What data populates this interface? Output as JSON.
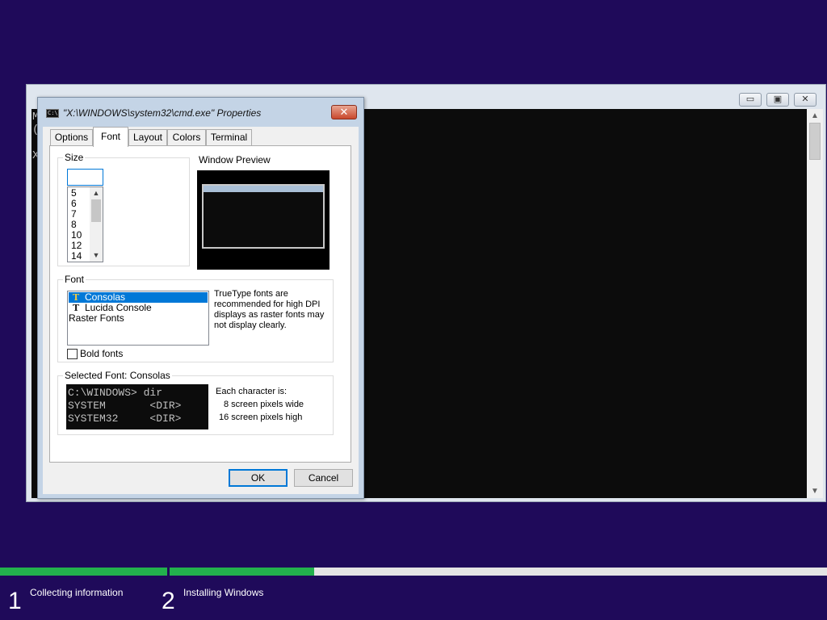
{
  "colors": {
    "desktop_bg": "#1f0a5a",
    "progress": "#23b14d",
    "selection": "#0078d7",
    "close_button": "#c9482c"
  },
  "console": {
    "lines": [
      "M",
      "(",
      "",
      "X"
    ],
    "caption_buttons": [
      "minimize-icon",
      "maximize-icon",
      "close-icon"
    ],
    "caption_glyphs": {
      "minimize": "▭",
      "maximize": "▣",
      "close": "✕"
    },
    "scroll_up": "▲",
    "scroll_down": "▼"
  },
  "dialog": {
    "title": "\"X:\\WINDOWS\\system32\\cmd.exe\" Properties",
    "title_icon_text": "C:\\",
    "close_glyph": "✕",
    "tabs": [
      "Options",
      "Font",
      "Layout",
      "Colors",
      "Terminal"
    ],
    "active_tab": "Font",
    "size": {
      "label": "Size",
      "input_value": "",
      "items": [
        "5",
        "6",
        "7",
        "8",
        "10",
        "12",
        "14"
      ],
      "scroll_up": "▲",
      "scroll_down": "▼"
    },
    "preview": {
      "label": "Window Preview"
    },
    "font": {
      "label": "Font",
      "items": [
        {
          "name": "Consolas",
          "icon": "truetype-icon",
          "glyph": "T",
          "selected": true
        },
        {
          "name": "Lucida Console",
          "icon": "truetype-icon",
          "glyph": "T",
          "selected": false
        },
        {
          "name": "Raster Fonts",
          "icon": "",
          "glyph": "",
          "selected": false
        }
      ],
      "hint": "TrueType fonts are recommended for high DPI displays as raster fonts may not display clearly.",
      "bold_label": "Bold fonts",
      "bold_checked": false
    },
    "selected_font": {
      "label": "Selected Font: Consolas",
      "sample_lines": [
        "C:\\WINDOWS> dir",
        "SYSTEM       <DIR>",
        "SYSTEM32     <DIR>"
      ],
      "char_info_title": "Each character is:",
      "width_text": "8 screen pixels wide",
      "height_text": "16 screen pixels high"
    },
    "ok_label": "OK",
    "cancel_label": "Cancel"
  },
  "setup_progress": {
    "steps": [
      {
        "number": "1",
        "label": "Collecting information",
        "progress": 1.0
      },
      {
        "number": "2",
        "label": "Installing Windows",
        "progress": 0.22
      }
    ]
  }
}
